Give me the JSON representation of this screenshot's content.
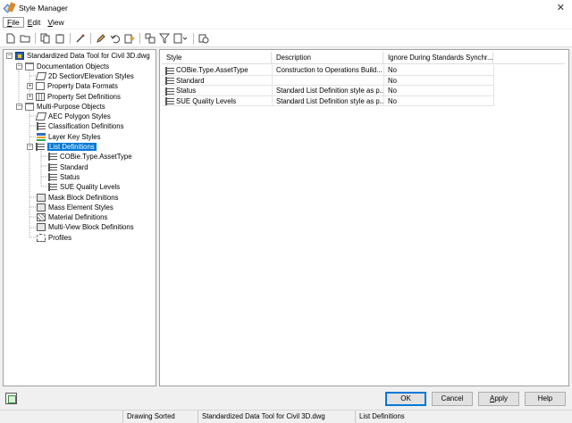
{
  "window": {
    "title": "Style Manager",
    "close_glyph": "✕"
  },
  "menu": [
    {
      "label": "File",
      "key": "F",
      "rest": "ile"
    },
    {
      "label": "Edit",
      "key": "E",
      "rest": "dit"
    },
    {
      "label": "View",
      "key": "V",
      "rest": "iew"
    }
  ],
  "toolbar_icons": [
    "new-icon",
    "open-icon",
    "copy-icon",
    "paste-icon",
    "purge-icon",
    "edit-icon",
    "undo-icon",
    "export-icon",
    "toggle-view-icon",
    "filter-icon",
    "view-dropdown-icon",
    "inventory-icon"
  ],
  "tree": {
    "root": "Standardized Data Tool for Civil 3D.dwg",
    "documentation_objects": "Documentation Objects",
    "section_elevation": "2D Section/Elevation Styles",
    "property_data_formats": "Property Data Formats",
    "property_set_definitions": "Property Set Definitions",
    "multi_purpose_objects": "Multi-Purpose Objects",
    "aec_polygon_styles": "AEC Polygon Styles",
    "classification_definitions": "Classification Definitions",
    "layer_key_styles": "Layer Key Styles",
    "list_definitions": "List Definitions",
    "cobie_asset_type": "COBie.Type.AssetType",
    "standard": "Standard",
    "status": "Status",
    "sue_quality_levels": "SUE Quality Levels",
    "mask_block_definitions": "Mask Block Definitions",
    "mass_element_styles": "Mass Element Styles",
    "material_definitions": "Material Definitions",
    "multi_view_block_definitions": "Multi-View Block Definitions",
    "profiles": "Profiles"
  },
  "table": {
    "headers": [
      "Style",
      "Description",
      "Ignore During Standards Synchr..."
    ],
    "rows": [
      [
        "COBie.Type.AssetType",
        "Construction to Operations Build...",
        "No"
      ],
      [
        "Standard",
        "",
        "No"
      ],
      [
        "Status",
        "Standard List Definition style as p...",
        "No"
      ],
      [
        "SUE Quality Levels",
        "Standard List Definition style as p...",
        "No"
      ]
    ]
  },
  "buttons": {
    "ok": "OK",
    "cancel": "Cancel",
    "apply_key": "A",
    "apply_rest": "pply",
    "help": "Help"
  },
  "status": {
    "sort": "Drawing Sorted",
    "drawing": "Standardized Data Tool for Civil 3D.dwg",
    "category": "List Definitions"
  },
  "colors": {
    "selection": "#0078d7",
    "accent": "#0078d7"
  }
}
